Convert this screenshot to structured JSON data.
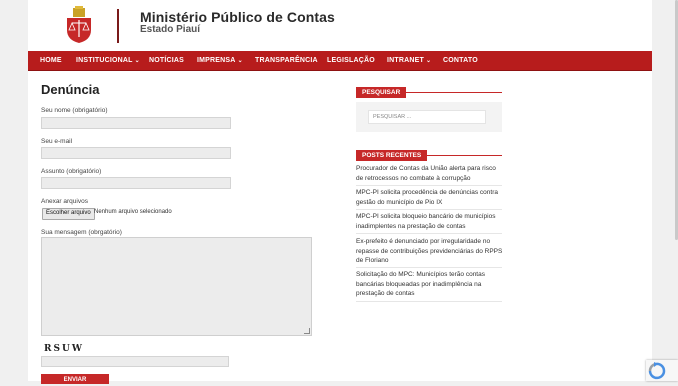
{
  "header": {
    "org_name": "Ministério Público de Contas",
    "org_sub": "Estado Piauí"
  },
  "nav": {
    "items": [
      {
        "label": "HOME"
      },
      {
        "label": "INSTITUCIONAL",
        "caret": "⌄"
      },
      {
        "label": "NOTÍCIAS"
      },
      {
        "label": "IMPRENSA",
        "caret": "⌄"
      },
      {
        "label": "TRANSPARÊNCIA"
      },
      {
        "label": "LEGISLAÇÃO"
      },
      {
        "label": "INTRANET",
        "caret": "⌄"
      },
      {
        "label": "CONTATO"
      }
    ]
  },
  "form": {
    "title": "Denúncia",
    "name_label": "Seu nome (obrigatório)",
    "email_label": "Seu e-mail",
    "subject_label": "Assunto (obrigatório)",
    "attach_label": "Anexar arquivos",
    "file_button": "Escolher arquivo",
    "file_status": "Nenhum arquivo selecionado",
    "message_label": "Sua mensagem (obrgatório)",
    "captcha_text": "RSUW",
    "submit_label": "ENVIAR"
  },
  "sidebar": {
    "search_title": "PESQUISAR",
    "search_placeholder": "PESQUISAR ...",
    "recent_title": "POSTS RECENTES",
    "posts": [
      "Procurador de Contas da União alerta para risco de retrocessos no combate à corrupção",
      "MPC-PI solicita procedência de denúncias contra gestão do município de Pio IX",
      "MPC-PI solicita bloqueio bancário de municípios inadimplentes na prestação de contas",
      "Ex-prefeito é denunciado por irregularidade no repasse de contribuições previdenciárias do RPPS de Floriano",
      "Solicitação do MPC: Municípios terão contas bancárias bloqueadas por inadimplência na prestação de contas"
    ]
  },
  "colors": {
    "brand_red": "#b71c1c",
    "accent_red": "#c62828"
  }
}
